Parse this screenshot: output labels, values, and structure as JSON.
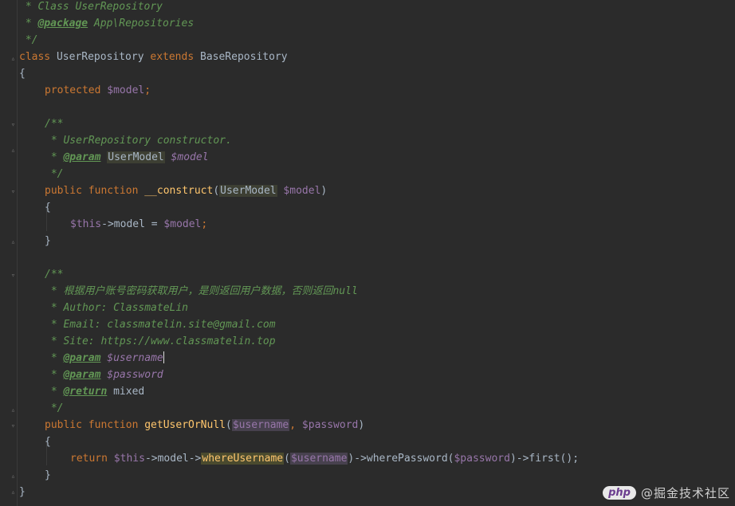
{
  "code": {
    "l1": " * Class UserRepository",
    "l2_tag": "@package",
    "l2_rest": " App\\Repositories",
    "l3": " */",
    "l4_kw1": "class",
    "l4_name": " UserRepository ",
    "l4_kw2": "extends",
    "l4_base": " BaseRepository",
    "l5": "{",
    "l6_kw": "protected",
    "l6_var": " $model",
    "l6_end": ";",
    "l8": "/**",
    "l9": " * UserRepository constructor.",
    "l10_star": " * ",
    "l10_tag": "@param",
    "l10_type": "UserModel",
    "l10_var": " $model",
    "l11": " */",
    "l12_kw": "public function ",
    "l12_fn": "__construct",
    "l12_open": "(",
    "l12_type": "UserModel",
    "l12_var": " $model",
    "l12_close": ")",
    "l13": "{",
    "l14_var1": "$this",
    "l14_mid": "->model = ",
    "l14_var2": "$model",
    "l14_end": ";",
    "l15": "}",
    "l17": "/**",
    "l18": " * 根据用户账号密码获取用户，是则返回用户数据，否则返回null",
    "l19": " * Author: ClassmateLin",
    "l20": " * Email: classmatelin.site@gmail.com",
    "l21": " * Site: https://www.classmatelin.top",
    "l22_star": " * ",
    "l22_tag": "@param",
    "l22_var": " $username",
    "l23_star": " * ",
    "l23_tag": "@param",
    "l23_var": " $password",
    "l24_star": " * ",
    "l24_tag": "@return",
    "l24_rest": " mixed",
    "l25": " */",
    "l26_kw": "public function ",
    "l26_fn": "getUserOrNull",
    "l26_open": "(",
    "l26_var1": "$username",
    "l26_comma": ", ",
    "l26_var2": "$password",
    "l26_close": ")",
    "l27": "{",
    "l28_kw": "return ",
    "l28_this": "$this",
    "l28_a": "->model->",
    "l28_fn1": "whereUsername",
    "l28_p1": "(",
    "l28_var1": "$username",
    "l28_p2": ")->wherePassword(",
    "l28_var2": "$password",
    "l28_p3": ")->first();",
    "l29": "}",
    "l30": "}"
  },
  "watermark": {
    "logo": "php",
    "text": "@掘金技术社区"
  },
  "colors": {
    "background": "#2b2b2b",
    "keyword": "#cc7832",
    "variable": "#9876aa",
    "function": "#ffc66d",
    "comment": "#629755",
    "text": "#a9b7c6"
  }
}
